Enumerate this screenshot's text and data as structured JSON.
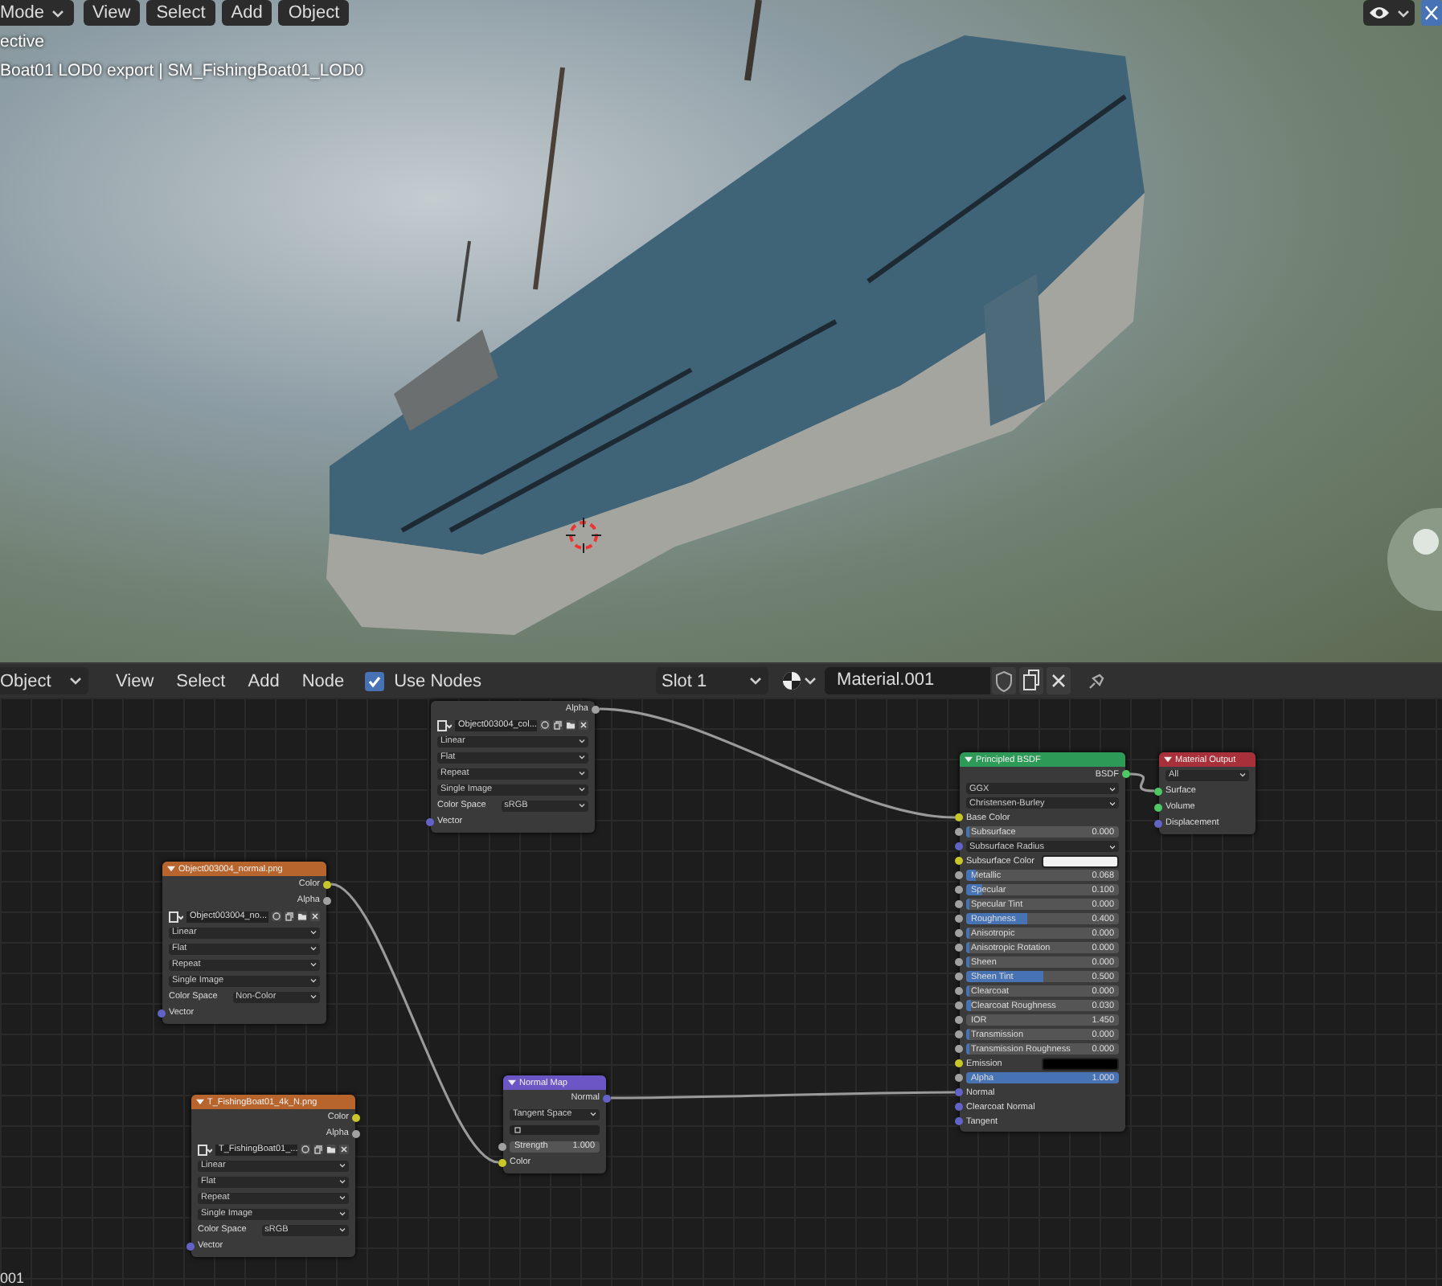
{
  "viewport": {
    "header": {
      "mode": "Mode",
      "menus": [
        "View",
        "Select",
        "Add",
        "Object"
      ]
    },
    "overlay_text": [
      "ective",
      "Boat01 LOD0 export | SM_FishingBoat01_LOD0"
    ]
  },
  "node_editor": {
    "header": {
      "object_mode": "Object",
      "menus": [
        "View",
        "Select",
        "Add",
        "Node"
      ],
      "use_nodes": {
        "label": "Use Nodes",
        "checked": true
      },
      "slot": "Slot 1",
      "material": "Material.001"
    },
    "nodes": [
      {
        "kind": "image",
        "rows": [
          {
            "kind": "out",
            "label": "Alpha",
            "socket": {
              "color": "#a1a1a1"
            }
          },
          {
            "kind": "image",
            "name": "Object003004_col..."
          },
          {
            "kind": "dropdown",
            "value": "Linear"
          },
          {
            "kind": "dropdown",
            "value": "Flat"
          },
          {
            "kind": "dropdown",
            "value": "Repeat"
          },
          {
            "kind": "dropdown",
            "value": "Single Image"
          },
          {
            "kind": "prop",
            "label": "Color Space",
            "value": "sRGB"
          },
          {
            "kind": "in",
            "label": "Vector",
            "socket": {
              "color": "#6363c7"
            }
          }
        ]
      },
      {
        "kind": "image",
        "title": "Object003004_normal.png",
        "color": "#b8652d",
        "rows": [
          {
            "kind": "out",
            "label": "Color",
            "socket": {
              "color": "#c7c729"
            }
          },
          {
            "kind": "out",
            "label": "Alpha",
            "socket": {
              "color": "#a1a1a1"
            }
          },
          {
            "kind": "image",
            "name": "Object003004_no..."
          },
          {
            "kind": "dropdown",
            "value": "Linear"
          },
          {
            "kind": "dropdown",
            "value": "Flat"
          },
          {
            "kind": "dropdown",
            "value": "Repeat"
          },
          {
            "kind": "dropdown",
            "value": "Single Image"
          },
          {
            "kind": "prop",
            "label": "Color Space",
            "value": "Non-Color"
          },
          {
            "kind": "in",
            "label": "Vector",
            "socket": {
              "color": "#6363c7"
            }
          }
        ]
      },
      {
        "kind": "image",
        "title": "T_FishingBoat01_4k_N.png",
        "color": "#b8652d",
        "rows": [
          {
            "kind": "out",
            "label": "Color",
            "socket": {
              "color": "#c7c729"
            }
          },
          {
            "kind": "out",
            "label": "Alpha",
            "socket": {
              "color": "#a1a1a1"
            }
          },
          {
            "kind": "image",
            "name": "T_FishingBoat01_..."
          },
          {
            "kind": "dropdown",
            "value": "Linear"
          },
          {
            "kind": "dropdown",
            "value": "Flat"
          },
          {
            "kind": "dropdown",
            "value": "Repeat"
          },
          {
            "kind": "dropdown",
            "value": "Single Image"
          },
          {
            "kind": "prop",
            "label": "Color Space",
            "value": "sRGB"
          },
          {
            "kind": "in",
            "label": "Vector",
            "socket": {
              "color": "#6363c7"
            }
          }
        ]
      },
      {
        "kind": "normal_map",
        "title": "Normal Map",
        "color": "#6c55c4",
        "rows": [
          {
            "kind": "out",
            "label": "Normal",
            "socket": {
              "color": "#6363c7"
            }
          },
          {
            "kind": "dropdown",
            "value": "Tangent Space"
          },
          {
            "kind": "field"
          },
          {
            "kind": "number",
            "label": "Strength",
            "value": "1.000",
            "socket": {
              "color": "#a1a1a1"
            }
          },
          {
            "kind": "in",
            "label": "Color",
            "socket": {
              "color": "#c7c729"
            }
          }
        ]
      },
      {
        "kind": "bsdf",
        "title": "Principled BSDF",
        "color": "#2e9a58",
        "rows": [
          {
            "kind": "out",
            "label": "BSDF",
            "socket": {
              "color": "#4ec764"
            }
          },
          {
            "kind": "dropdown",
            "value": "GGX"
          },
          {
            "kind": "dropdown",
            "value": "Christensen-Burley"
          },
          {
            "kind": "in",
            "label": "Base Color",
            "socket": {
              "color": "#c7c729"
            }
          },
          {
            "kind": "slider",
            "label": "Subsurface",
            "value": "0.000",
            "level": 0,
            "socket": {
              "color": "#a1a1a1"
            }
          },
          {
            "kind": "dropdown",
            "value": "Subsurface Radius",
            "socket": {
              "color": "#6363c7"
            }
          },
          {
            "kind": "color",
            "label": "Subsurface Color",
            "color": "#f2f2f2",
            "socket": {
              "color": "#c7c729"
            }
          },
          {
            "kind": "slider",
            "label": "Metallic",
            "value": "0.068",
            "level": 0.068,
            "socket": {
              "color": "#a1a1a1"
            }
          },
          {
            "kind": "slider",
            "label": "Specular",
            "value": "0.100",
            "level": 0.1,
            "socket": {
              "color": "#a1a1a1"
            }
          },
          {
            "kind": "slider",
            "label": "Specular Tint",
            "value": "0.000",
            "level": 0,
            "socket": {
              "color": "#a1a1a1"
            }
          },
          {
            "kind": "slider",
            "label": "Roughness",
            "value": "0.400",
            "level": 0.4,
            "socket": {
              "color": "#a1a1a1"
            }
          },
          {
            "kind": "slider",
            "label": "Anisotropic",
            "value": "0.000",
            "level": 0,
            "socket": {
              "color": "#a1a1a1"
            }
          },
          {
            "kind": "slider",
            "label": "Anisotropic Rotation",
            "value": "0.000",
            "level": 0,
            "socket": {
              "color": "#a1a1a1"
            }
          },
          {
            "kind": "slider",
            "label": "Sheen",
            "value": "0.000",
            "level": 0,
            "socket": {
              "color": "#a1a1a1"
            }
          },
          {
            "kind": "slider",
            "label": "Sheen Tint",
            "value": "0.500",
            "level": 0.5,
            "socket": {
              "color": "#a1a1a1"
            }
          },
          {
            "kind": "slider",
            "label": "Clearcoat",
            "value": "0.000",
            "level": 0,
            "socket": {
              "color": "#a1a1a1"
            }
          },
          {
            "kind": "slider",
            "label": "Clearcoat Roughness",
            "value": "0.030",
            "level": 0.03,
            "socket": {
              "color": "#a1a1a1"
            }
          },
          {
            "kind": "number",
            "label": "IOR",
            "value": "1.450",
            "socket": {
              "color": "#a1a1a1"
            }
          },
          {
            "kind": "slider",
            "label": "Transmission",
            "value": "0.000",
            "level": 0,
            "socket": {
              "color": "#a1a1a1"
            }
          },
          {
            "kind": "slider",
            "label": "Transmission Roughness",
            "value": "0.000",
            "level": 0,
            "socket": {
              "color": "#a1a1a1"
            }
          },
          {
            "kind": "color",
            "label": "Emission",
            "color": "#000000",
            "socket": {
              "color": "#c7c729"
            }
          },
          {
            "kind": "slider",
            "label": "Alpha",
            "value": "1.000",
            "level": 1,
            "socket": {
              "color": "#a1a1a1"
            }
          },
          {
            "kind": "in",
            "label": "Normal",
            "socket": {
              "color": "#6363c7"
            }
          },
          {
            "kind": "in",
            "label": "Clearcoat Normal",
            "socket": {
              "color": "#6363c7"
            }
          },
          {
            "kind": "in",
            "label": "Tangent",
            "socket": {
              "color": "#6363c7"
            }
          }
        ]
      },
      {
        "kind": "output",
        "title": "Material Output",
        "color": "#a8303a",
        "rows": [
          {
            "kind": "dropdown",
            "value": "All"
          },
          {
            "kind": "in",
            "label": "Surface",
            "socket": {
              "color": "#4ec764"
            }
          },
          {
            "kind": "in",
            "label": "Volume",
            "socket": {
              "color": "#4ec764"
            }
          },
          {
            "kind": "in",
            "label": "Displacement",
            "socket": {
              "color": "#6363c7"
            }
          }
        ]
      }
    ],
    "footer_text": "001"
  }
}
